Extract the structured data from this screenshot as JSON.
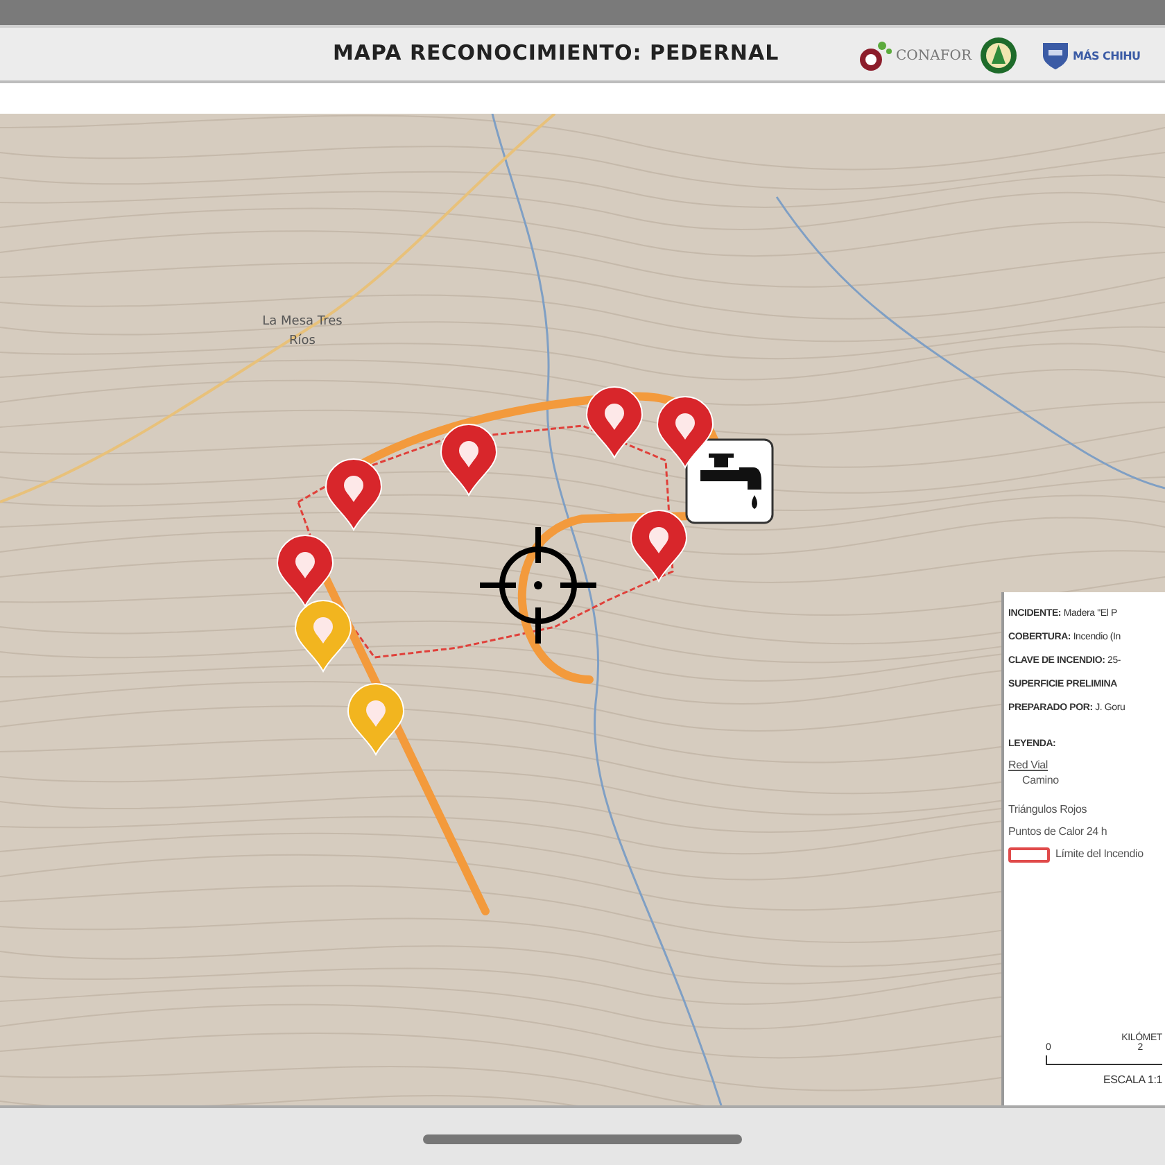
{
  "header": {
    "title": "MAPA RECONOCIMIENTO: PEDERNAL",
    "logos": [
      {
        "kind": "conafor",
        "text": "CONAFOR"
      },
      {
        "kind": "seal"
      },
      {
        "kind": "shield",
        "text": "MÁS CHIHU"
      }
    ]
  },
  "map": {
    "place_labels": [
      "La Mesa Tres Ríos"
    ],
    "markers": [
      {
        "color": "#d8262b"
      },
      {
        "color": "#d8262b"
      },
      {
        "color": "#d8262b"
      },
      {
        "color": "#d8262b"
      },
      {
        "color": "#d8262b"
      },
      {
        "color": "#d8262b"
      },
      {
        "color": "#f2b51f"
      },
      {
        "color": "#f2b51f"
      }
    ]
  },
  "legend": {
    "info": [
      {
        "label": "INCIDENTE:",
        "value": "Madera \"El P"
      },
      {
        "label": "COBERTURA:",
        "value": "Incendio (In"
      },
      {
        "label": "CLAVE DE INCENDIO:",
        "value": "25-"
      },
      {
        "label": "SUPERFICIE PRELIMINA"
      },
      {
        "label": "PREPARADO POR:",
        "value": "J. Goru"
      }
    ],
    "title": "LEYENDA:",
    "items": [
      {
        "kind": "road",
        "label": "Red Vial",
        "sublabel": "Camino"
      },
      {
        "kind": "text",
        "label": "Triángulos Rojos"
      },
      {
        "kind": "text",
        "label": "Puntos de Calor 24 h"
      },
      {
        "kind": "perimeter",
        "label": "Límite del Incendio"
      }
    ],
    "scale": {
      "unit": "KILÓMET",
      "ticks": [
        "0",
        "2"
      ],
      "text": "ESCALA 1:1"
    }
  }
}
